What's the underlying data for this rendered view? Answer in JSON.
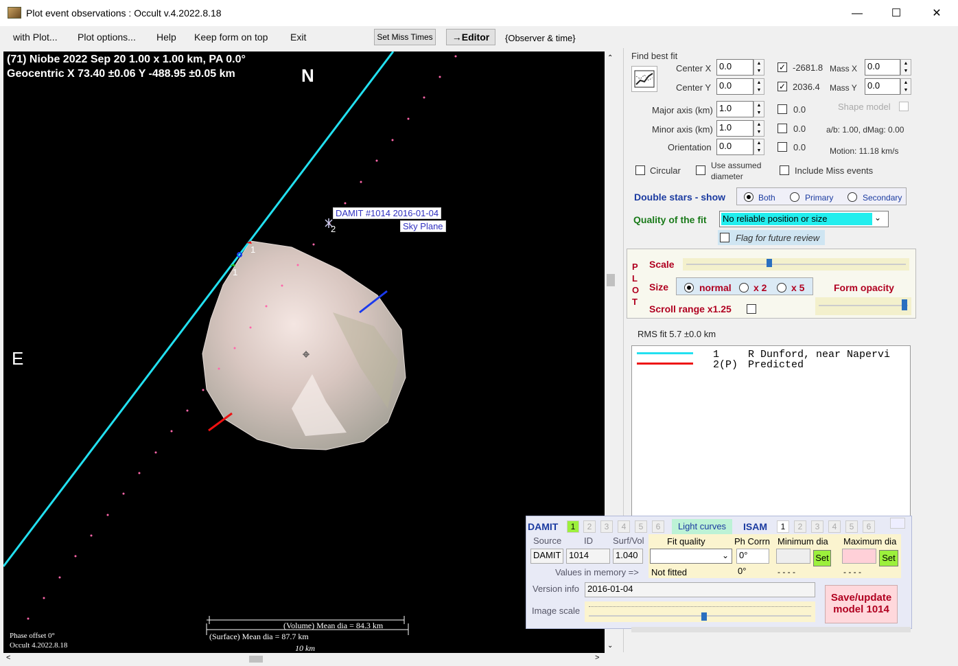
{
  "window": {
    "title": "Plot event observations : Occult v.4.2022.8.18"
  },
  "menu": {
    "items": [
      "with Plot...",
      "Plot options...",
      "Help",
      "Keep form on top",
      "Exit"
    ],
    "set_miss_times": "Set Miss Times",
    "editor": "→Editor",
    "observer_time": "{Observer & time}"
  },
  "plot": {
    "line1": "(71) Niobe  2022 Sep 20   1.00 x 1.00 km, PA 0.0°",
    "line2": "Geocentric  X  73.40 ±0.06  Y -488.95 ±0.05 km",
    "north": "N",
    "east": "E",
    "damit_label1": "DAMIT #1014 2016-01-04",
    "damit_label2": "Sky Plane",
    "chord1": "1",
    "chord1b": "1",
    "chord2": "2",
    "phase_offset": "Phase offset 0°",
    "version": "Occult 4.2022.8.18",
    "volume_dia": "(Volume) Mean dia = 84.3 km",
    "surface_dia": "(Surface) Mean dia = 87.7 km",
    "scale_km": "10 km"
  },
  "fit": {
    "find_best_fit": "Find best fit",
    "center_x_label": "Center X",
    "center_x": "0.0",
    "center_y_label": "Center Y",
    "center_y": "0.0",
    "major_label": "Major axis (km)",
    "major": "1.0",
    "minor_label": "Minor axis (km)",
    "minor": "1.0",
    "orient_label": "Orientation",
    "orient": "0.0",
    "cx_val": "-2681.8",
    "cy_val": "2036.4",
    "mass_x_label": "Mass X",
    "mass_x": "0.0",
    "mass_y_label": "Mass Y",
    "mass_y": "0.0",
    "major_chk": "0.0",
    "minor_chk": "0.0",
    "orient_chk": "0.0",
    "shape_model": "Shape model",
    "ab": "a/b: 1.00, dMag: 0.00",
    "motion": "Motion: 11.18 km/s",
    "circular": "Circular",
    "use_assumed1": "Use assumed",
    "use_assumed2": "diameter",
    "include_miss": "Include Miss events"
  },
  "double_stars": {
    "label": "Double stars - show",
    "both": "Both",
    "primary": "Primary",
    "secondary": "Secondary"
  },
  "quality": {
    "label": "Quality of the fit",
    "value": "No reliable position or size",
    "flag": "Flag for future review"
  },
  "plot_opts": {
    "vertical": "P L O T",
    "scale": "Scale",
    "size": "Size",
    "normal": "normal",
    "x2": "x 2",
    "x5": "x 5",
    "form_opacity": "Form opacity",
    "scroll_range": "Scroll range x1.25"
  },
  "rms": {
    "label": "RMS fit 5.7 ±0.0 km",
    "rows": [
      {
        "num": "1",
        "name": "R Dunford, near Napervi",
        "color": "#22e0f0"
      },
      {
        "num": "2(P)",
        "name": "Predicted",
        "color": "#ee1111"
      }
    ]
  },
  "damit_panel": {
    "damit": "DAMIT",
    "damit_nums": [
      "1",
      "2",
      "3",
      "4",
      "5",
      "6"
    ],
    "light_curves": "Light curves",
    "isam": "ISAM",
    "isam_nums": [
      "1",
      "2",
      "3",
      "4",
      "5",
      "6"
    ],
    "source_h": "Source",
    "id_h": "ID",
    "surf_h": "Surf/Vol",
    "source": "DAMIT",
    "id": "1014",
    "surf": "1.040",
    "fit_quality_h": "Fit quality",
    "ph_corrn_h": "Ph Corrn",
    "min_dia_h": "Minimum dia",
    "max_dia_h": "Maximum dia",
    "ph_corrn": "0°",
    "set": "Set",
    "values_in_memory": "Values in memory =>",
    "not_fitted": "Not fitted",
    "ph_mem": "0°",
    "dash1": "- - - -",
    "dash2": "- - - -",
    "version_info_label": "Version info",
    "version_info": "2016-01-04",
    "image_scale": "Image scale",
    "save1": "Save/update",
    "save2": "model 1014"
  }
}
